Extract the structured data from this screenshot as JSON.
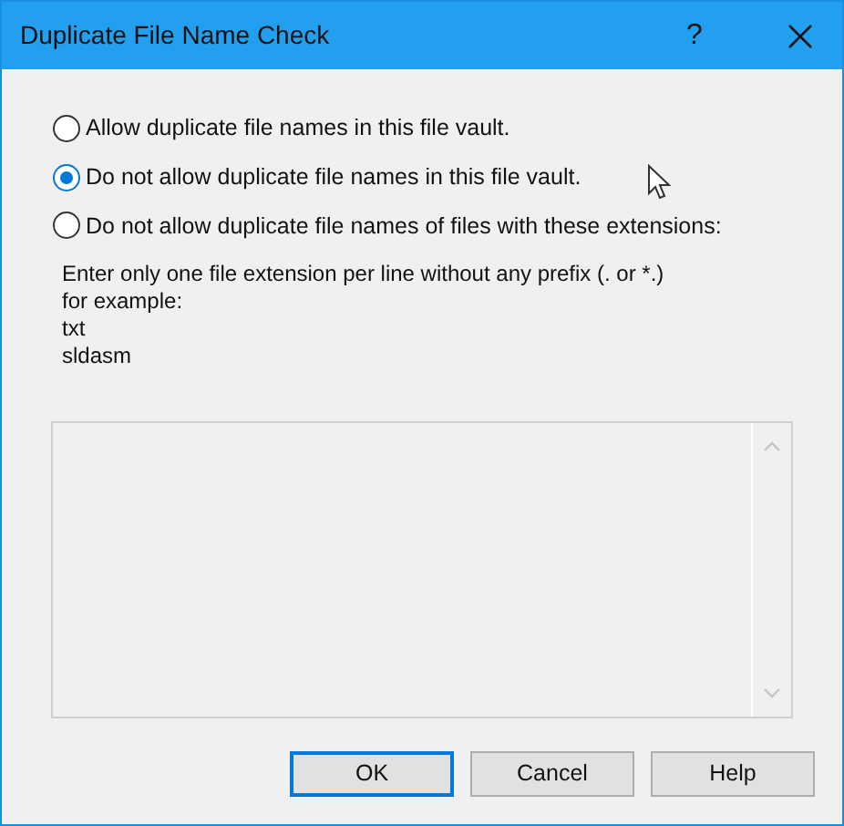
{
  "window": {
    "title": "Duplicate File Name Check",
    "help_button": "?"
  },
  "options": [
    {
      "label": "Allow duplicate file names in this file vault.",
      "selected": false
    },
    {
      "label": "Do not allow duplicate file names in this file vault.",
      "selected": true
    },
    {
      "label": "Do not allow duplicate file names of files with these extensions:",
      "selected": false
    }
  ],
  "instructions": [
    "Enter only one file extension per line without any prefix (. or *.)",
    "for example:",
    "txt",
    "sldasm"
  ],
  "extensions_box": {
    "disabled": true
  },
  "buttons": [
    {
      "label": "OK",
      "default": true
    },
    {
      "label": "Cancel",
      "default": false
    },
    {
      "label": "Help",
      "default": false
    }
  ]
}
